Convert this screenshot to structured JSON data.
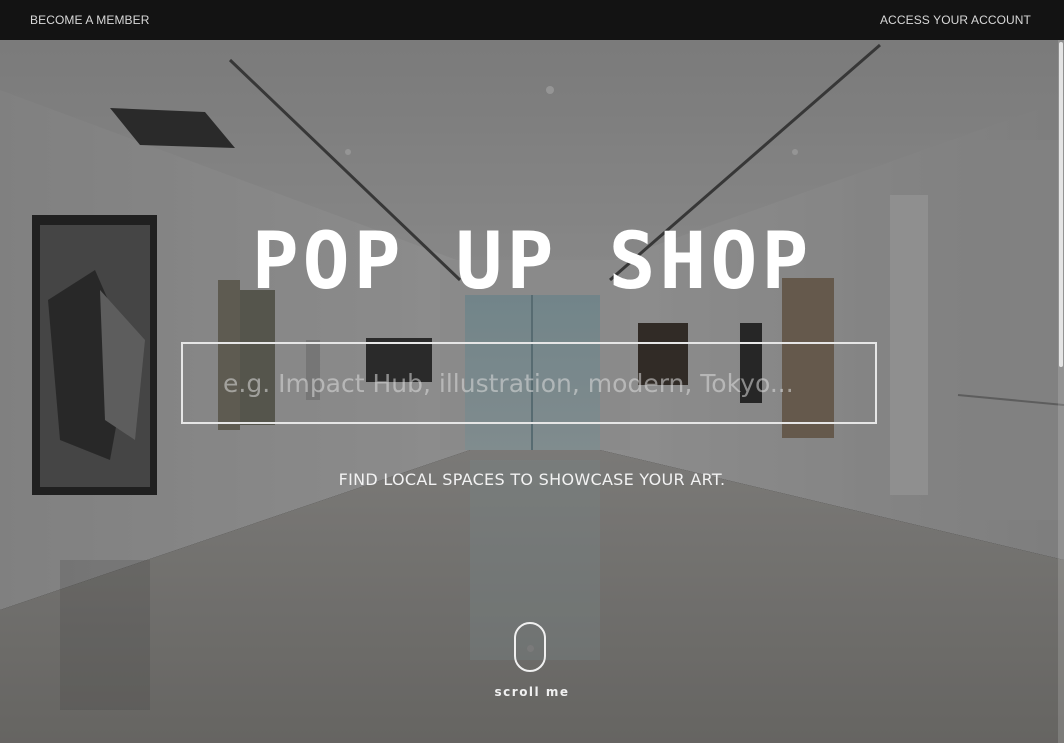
{
  "nav": {
    "left_label": "BECOME A MEMBER",
    "right_label": "ACCESS YOUR ACCOUNT"
  },
  "hero": {
    "title": "POP UP SHOP",
    "search_placeholder": "e.g. Impact Hub, illustration, modern, Tokyo...",
    "search_value": "",
    "tagline": "FIND LOCAL SPACES TO SHOWCASE YOUR ART.",
    "scroll_label": "scroll me"
  },
  "icons": {
    "scroll": "mouse-scroll-icon"
  },
  "colors": {
    "topbar": "#131313",
    "text": "#ffffff",
    "search_border": "#e6e6e6"
  }
}
